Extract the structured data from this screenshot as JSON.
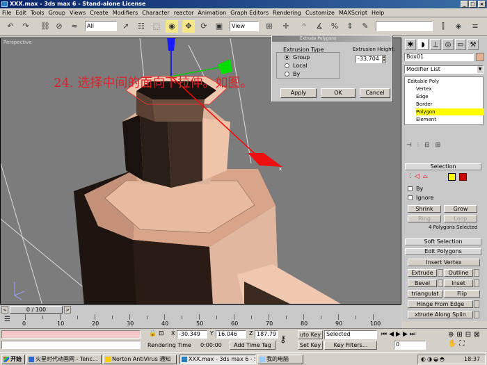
{
  "window": {
    "title": "XXX.max - 3ds max 6 - Stand-alone License",
    "min": "_",
    "max": "□",
    "close": "×"
  },
  "menu": [
    "File",
    "Edit",
    "Tools",
    "Group",
    "Views",
    "Create",
    "Modifiers",
    "Character",
    "reactor",
    "Animation",
    "Graph Editors",
    "Rendering",
    "Customize",
    "MAXScript",
    "Help"
  ],
  "toolbar": {
    "filter_select": "All",
    "view_select": "View"
  },
  "viewport": {
    "label": "Perspective"
  },
  "tutorial_text": "24. 选择中间的面向下拉伸。如图。",
  "dialog": {
    "title": "Extrude Polygons",
    "type_label": "Extrusion Type",
    "options": [
      "Group",
      "Local",
      "By"
    ],
    "height_label": "Extrusion Height:",
    "height_value": "-33.704",
    "apply": "Apply",
    "ok": "OK",
    "cancel": "Cancel"
  },
  "panel": {
    "object_name": "Box01",
    "modifier_list": "Modifier List",
    "stack": [
      "Editable Poly",
      "Vertex",
      "Edge",
      "Border",
      "Polygon",
      "Element"
    ],
    "selection_header": "Selection",
    "by_label": "By",
    "ignore_label": "Ignore",
    "shrink": "Shrink",
    "grow": "Grow",
    "ring": "Ring",
    "loop": "Loop",
    "polygons_selected": "4 Polygons Selected",
    "soft_selection": "Soft Selection",
    "edit_polygons": "Edit Polygons",
    "insert_vertex": "Insert Vertex",
    "extrude": "Extrude",
    "outline": "Outline",
    "bevel": "Bevel",
    "inset": "Inset",
    "triangulate": "triangulat",
    "flip": "Flip",
    "hinge": "Hinge From Edge",
    "extrude_spline": "xtrude Along Splin"
  },
  "timeline": {
    "frame": "0 / 100"
  },
  "ruler": {
    "ticks": [
      "0",
      "10",
      "20",
      "30",
      "40",
      "50",
      "60",
      "70",
      "80",
      "90",
      "100"
    ]
  },
  "status": {
    "x_label": "X",
    "x_value": "-30.349",
    "y_label": "Y",
    "y_value": "16.046",
    "z_label": "Z",
    "z_value": "187.79",
    "rendering_time_label": "Rendering Time",
    "rendering_time": "0:00:00",
    "add_time_tag": "Add Time Tag",
    "auto_key": "uto Key",
    "selected": "Selected",
    "set_key": "Set Key",
    "key_filters": "Key Filters...",
    "frame_value": "0"
  },
  "taskbar": {
    "start": "开始",
    "tasks": [
      "火星时代动画网 - Tenc...",
      "Norton AntiVirus 通知",
      "XXX.max - 3ds max 6 - S...",
      "我的电脑"
    ],
    "clock": "18:37"
  },
  "colors": {
    "accent": "#0a246a",
    "highlight": "#ffff00",
    "tutorial": "#e0202a"
  }
}
